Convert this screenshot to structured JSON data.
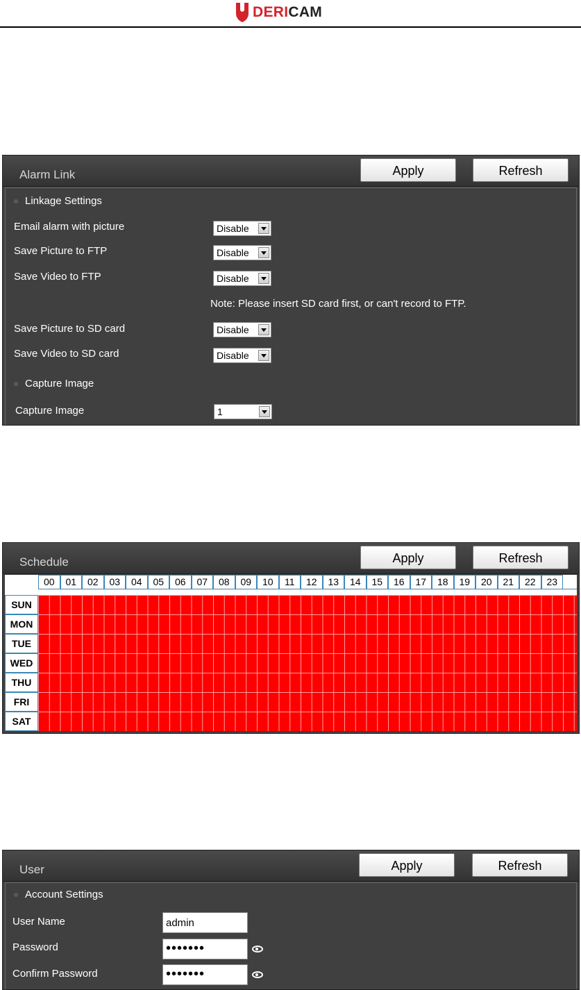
{
  "brand": {
    "logo_red": "DERI",
    "logo_dark": "CAM"
  },
  "colors": {
    "accent_red": "#d4232a",
    "schedule_fill": "#ff0000",
    "panel_bg": "#404040"
  },
  "alarm_link": {
    "title": "Alarm Link",
    "apply_label": "Apply",
    "refresh_label": "Refresh",
    "section_linkage": "Linkage Settings",
    "rows": [
      {
        "label": "Email alarm with picture",
        "value": "Disable"
      },
      {
        "label": "Save Picture to FTP",
        "value": "Disable"
      },
      {
        "label": "Save Video to FTP",
        "value": "Disable"
      },
      {
        "label": "Save Picture to SD card",
        "value": "Disable"
      },
      {
        "label": "Save Video to SD card",
        "value": "Disable"
      }
    ],
    "note": "Note: Please insert SD card first, or can't record to FTP.",
    "section_capture": "Capture Image",
    "capture_label": "Capture Image",
    "capture_value": "1"
  },
  "schedule": {
    "title": "Schedule",
    "apply_label": "Apply",
    "refresh_label": "Refresh",
    "hours": [
      "00",
      "01",
      "02",
      "03",
      "04",
      "05",
      "06",
      "07",
      "08",
      "09",
      "10",
      "11",
      "12",
      "13",
      "14",
      "15",
      "16",
      "17",
      "18",
      "19",
      "20",
      "21",
      "22",
      "23"
    ],
    "days": [
      "SUN",
      "MON",
      "TUE",
      "WED",
      "THU",
      "FRI",
      "SAT"
    ]
  },
  "user": {
    "title": "User",
    "apply_label": "Apply",
    "refresh_label": "Refresh",
    "section_account": "Account Settings",
    "username_label": "User Name",
    "username_value": "admin",
    "password_label": "Password",
    "password_value": "•••••••",
    "confirm_label": "Confirm Password",
    "confirm_value": "•••••••"
  }
}
